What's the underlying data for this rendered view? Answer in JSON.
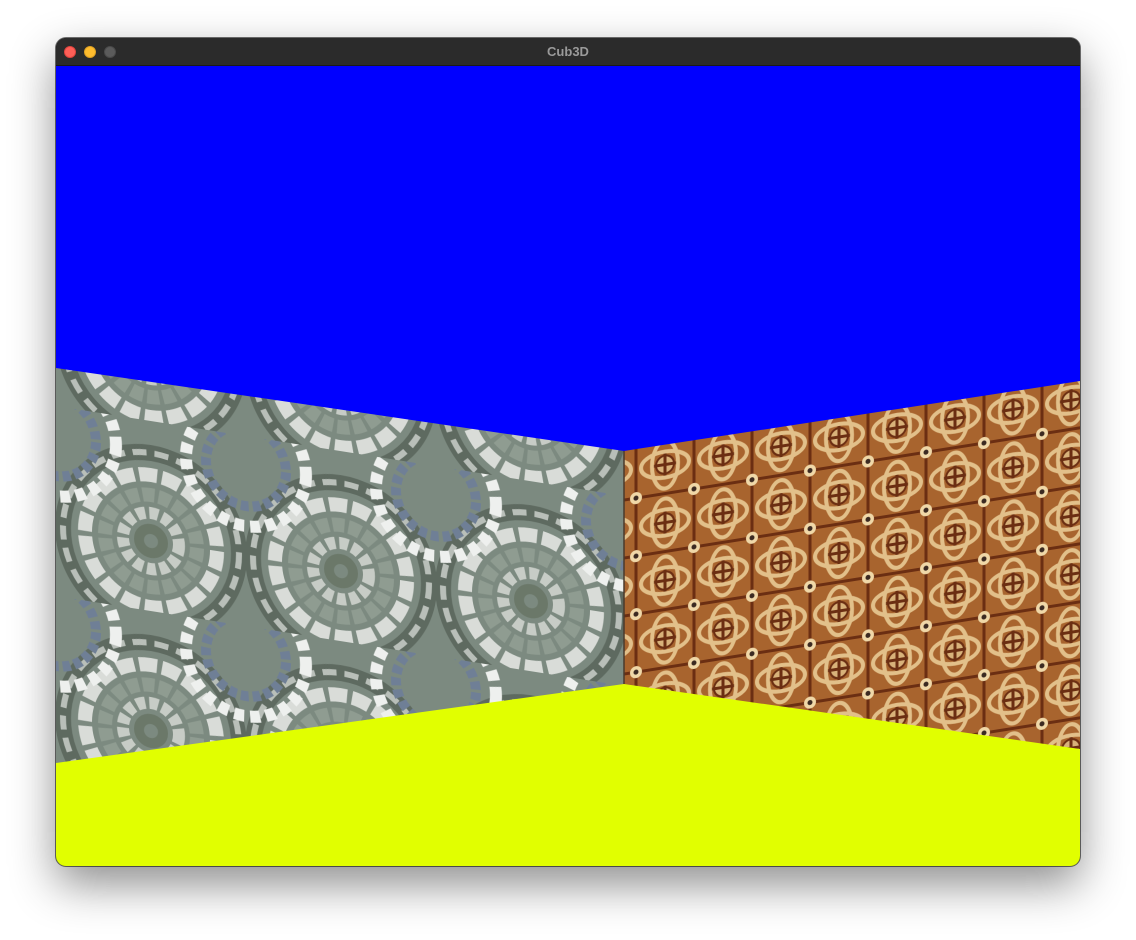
{
  "window": {
    "title": "Cub3D"
  },
  "scene": {
    "ceiling_color": "#0000ff",
    "floor_color": "#e1ff00",
    "left_wall_texture": "stone-circles-texture",
    "right_wall_texture": "ornate-mosaic-texture",
    "stone_colors": [
      "#8d9a8f",
      "#c9ccc9",
      "#5f6b62",
      "#e6e8e6",
      "#6f7f96"
    ],
    "mosaic_colors": [
      "#8a4a1c",
      "#d8b27a",
      "#6b2e12",
      "#f0d8a8",
      "#3b2a22"
    ]
  }
}
